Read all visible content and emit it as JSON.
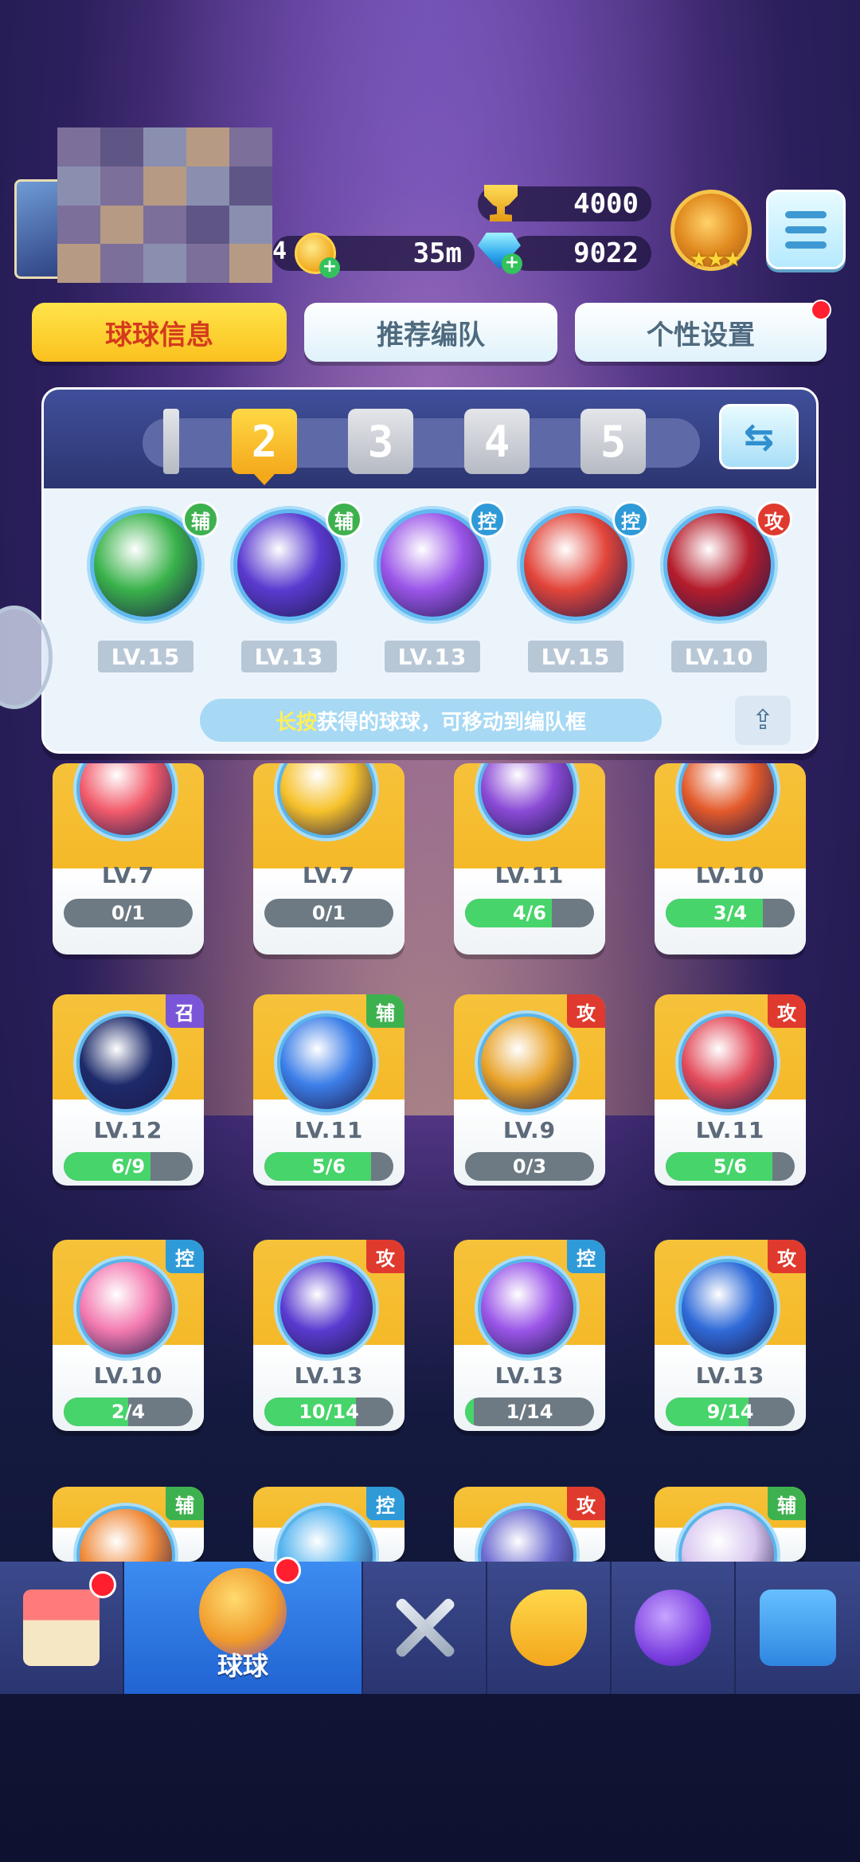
{
  "hud": {
    "trophies": "4000",
    "coins_level": "4",
    "coins": "35m",
    "gems": "9022"
  },
  "tabs": [
    {
      "label": "球球信息",
      "active": true
    },
    {
      "label": "推荐编队",
      "active": false
    },
    {
      "label": "个性设置",
      "active": false
    }
  ],
  "team_panel": {
    "teams": [
      "1",
      "2",
      "3",
      "4",
      "5"
    ],
    "selected_team": "2",
    "balls": [
      {
        "role": "辅",
        "role_color": "#3eb14f",
        "ball_color": "#39b24a",
        "level": "LV.15"
      },
      {
        "role": "辅",
        "role_color": "#3eb14f",
        "ball_color": "#5a3ad0",
        "level": "LV.13"
      },
      {
        "role": "控",
        "role_color": "#2f9ad8",
        "ball_color": "#9a55e8",
        "level": "LV.13"
      },
      {
        "role": "控",
        "role_color": "#2f9ad8",
        "ball_color": "#e2453a",
        "level": "LV.15"
      },
      {
        "role": "攻",
        "role_color": "#e03a2e",
        "ball_color": "#b51d2c",
        "level": "LV.10"
      }
    ],
    "hint_highlight": "长按",
    "hint_text": "获得的球球，可移动到编队框"
  },
  "cards": [
    {
      "level": "LV.7",
      "progress": "0/1",
      "fill": 0,
      "role": "",
      "ball_color": "#f25b6b"
    },
    {
      "level": "LV.7",
      "progress": "0/1",
      "fill": 0,
      "role": "",
      "ball_color": "#f6c12a"
    },
    {
      "level": "LV.11",
      "progress": "4/6",
      "fill": 0.67,
      "role": "",
      "ball_color": "#8a4ad6"
    },
    {
      "level": "LV.10",
      "progress": "3/4",
      "fill": 0.75,
      "role": "",
      "ball_color": "#e35a2a"
    },
    {
      "level": "LV.12",
      "progress": "6/9",
      "fill": 0.67,
      "role": "召",
      "role_class": "p",
      "ball_color": "#1d2a6a"
    },
    {
      "level": "LV.11",
      "progress": "5/6",
      "fill": 0.83,
      "role": "辅",
      "role_class": "g",
      "ball_color": "#3c7ee8"
    },
    {
      "level": "LV.9",
      "progress": "0/3",
      "fill": 0,
      "role": "攻",
      "role_class": "r",
      "ball_color": "#e8a22a"
    },
    {
      "level": "LV.11",
      "progress": "5/6",
      "fill": 0.83,
      "role": "攻",
      "role_class": "r",
      "ball_color": "#e24a5a"
    },
    {
      "level": "LV.10",
      "progress": "2/4",
      "fill": 0.5,
      "role": "控",
      "role_class": "b",
      "ball_color": "#f37ab0"
    },
    {
      "level": "LV.13",
      "progress": "10/14",
      "fill": 0.71,
      "role": "攻",
      "role_class": "r",
      "ball_color": "#5a3ad0"
    },
    {
      "level": "LV.13",
      "progress": "1/14",
      "fill": 0.07,
      "role": "控",
      "role_class": "b",
      "ball_color": "#9a55e8"
    },
    {
      "level": "LV.13",
      "progress": "9/14",
      "fill": 0.64,
      "role": "攻",
      "role_class": "r",
      "ball_color": "#2f6ad8"
    },
    {
      "level": "",
      "progress": "",
      "fill": 0,
      "role": "辅",
      "role_class": "g",
      "ball_color": "#f08a3a"
    },
    {
      "level": "",
      "progress": "",
      "fill": 0,
      "role": "控",
      "role_class": "b",
      "ball_color": "#58b5f0"
    },
    {
      "level": "",
      "progress": "",
      "fill": 0,
      "role": "攻",
      "role_class": "r",
      "ball_color": "#6c6ad0"
    },
    {
      "level": "",
      "progress": "",
      "fill": 0,
      "role": "辅",
      "role_class": "g",
      "ball_color": "#d9c7f0"
    }
  ],
  "bottom_nav": [
    {
      "icon": "shop-icon",
      "label": "",
      "active": false,
      "badge": true
    },
    {
      "icon": "ball-icon",
      "label": "球球",
      "active": true,
      "badge": true
    },
    {
      "icon": "swords-icon",
      "label": "",
      "active": false,
      "badge": false
    },
    {
      "icon": "whistle-icon",
      "label": "",
      "active": false,
      "badge": false
    },
    {
      "icon": "planet-icon",
      "label": "",
      "active": false,
      "badge": false
    },
    {
      "icon": "chat-heart-icon",
      "label": "",
      "active": false,
      "badge": false
    }
  ]
}
